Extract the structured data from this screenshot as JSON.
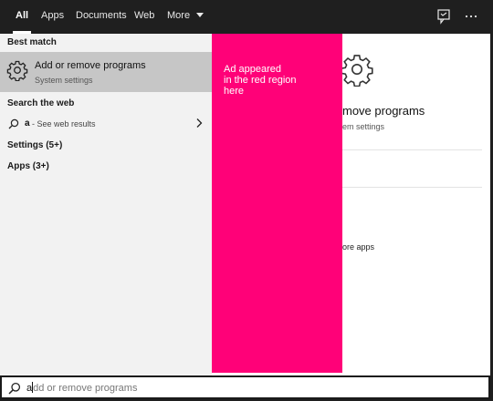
{
  "topbar": {
    "tabs": [
      {
        "label": "All",
        "active": true
      },
      {
        "label": "Apps"
      },
      {
        "label": "Documents"
      },
      {
        "label": "Web"
      },
      {
        "label": "More"
      }
    ],
    "feedback_icon": "feedback-icon",
    "more_options_icon": "ellipsis-icon"
  },
  "left": {
    "best_match_header": "Best match",
    "best_match": {
      "title": "Add or remove programs",
      "subtitle": "System settings",
      "icon": "gear-icon"
    },
    "search_web_header": "Search the web",
    "web_result": {
      "query": "a",
      "suffix": "- See web results",
      "icon": "search-icon"
    },
    "settings_category": "Settings (5+)",
    "apps_category": "Apps (3+)"
  },
  "ad": {
    "text": "Ad appeared\nin the red region\nhere",
    "color": "#ff0178"
  },
  "right": {
    "title_visible": "move programs",
    "subtitle_visible": "em settings",
    "apps_link_visible": "ore apps",
    "icon": "gear-icon"
  },
  "searchbox": {
    "typed": "a",
    "completion": "dd or remove programs",
    "icon": "search-icon"
  }
}
